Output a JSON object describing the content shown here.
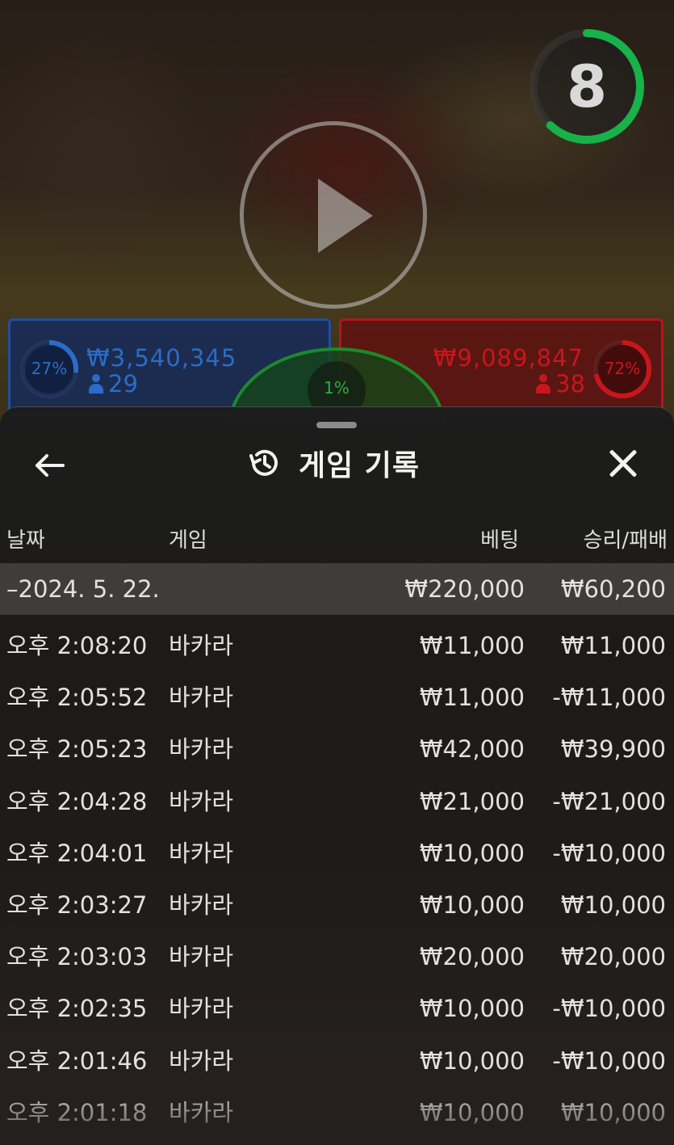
{
  "timer": {
    "value": "8",
    "progress": 0.62,
    "color": "#17b24a"
  },
  "player": {
    "percent": "27%",
    "percent_value": 0.27,
    "amount": "₩3,540,345",
    "count": "29",
    "color": "#2b6cc8"
  },
  "banker": {
    "percent": "72%",
    "percent_value": 0.72,
    "amount": "₩9,089,847",
    "count": "38",
    "color": "#c8161c"
  },
  "tie": {
    "percent": "1%",
    "color": "#2fae3c"
  },
  "header": {
    "title": "게임 기록",
    "back_icon": "arrow-left-icon",
    "history_icon": "history-icon",
    "close_icon": "close-icon"
  },
  "columns": {
    "date": "날짜",
    "game": "게임",
    "bet": "베팅",
    "win_loss": "승리/패배"
  },
  "date_group": {
    "date": "–2024. 5. 22.",
    "bet_total": "₩220,000",
    "win_total": "₩60,200"
  },
  "rows": [
    {
      "time": "오후 2:08:20",
      "game": "바카라",
      "bet": "₩11,000",
      "result": "₩11,000"
    },
    {
      "time": "오후 2:05:52",
      "game": "바카라",
      "bet": "₩11,000",
      "result": "-₩11,000"
    },
    {
      "time": "오후 2:05:23",
      "game": "바카라",
      "bet": "₩42,000",
      "result": "₩39,900"
    },
    {
      "time": "오후 2:04:28",
      "game": "바카라",
      "bet": "₩21,000",
      "result": "-₩21,000"
    },
    {
      "time": "오후 2:04:01",
      "game": "바카라",
      "bet": "₩10,000",
      "result": "-₩10,000"
    },
    {
      "time": "오후 2:03:27",
      "game": "바카라",
      "bet": "₩10,000",
      "result": "₩10,000"
    },
    {
      "time": "오후 2:03:03",
      "game": "바카라",
      "bet": "₩20,000",
      "result": "₩20,000"
    },
    {
      "time": "오후 2:02:35",
      "game": "바카라",
      "bet": "₩10,000",
      "result": "-₩10,000"
    },
    {
      "time": "오후 2:01:46",
      "game": "바카라",
      "bet": "₩10,000",
      "result": "-₩10,000"
    },
    {
      "time": "오후 2:01:18",
      "game": "바카라",
      "bet": "₩10,000",
      "result": "₩10,000"
    }
  ]
}
